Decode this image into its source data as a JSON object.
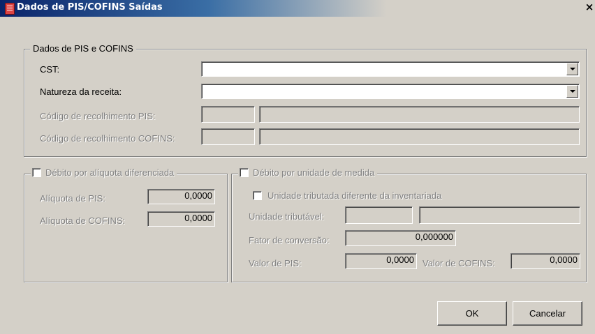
{
  "window": {
    "title": "Dados de PIS/COFINS Saídas",
    "close": "×"
  },
  "group_pis_cofins": {
    "legend": "Dados de PIS e COFINS",
    "cst_label": "CST:",
    "cst_value": "",
    "natureza_label": "Natureza da receita:",
    "natureza_value": "",
    "cod_pis_label": "Código de recolhimento PIS:",
    "cod_cofins_label": "Código de recolhimento COFINS:"
  },
  "group_aliquota": {
    "legend": "Débito por alíquota diferenciada",
    "checked": false,
    "aliq_pis_label": "Alíquota de PIS:",
    "aliq_pis_value": "0,0000",
    "aliq_cofins_label": "Alíquota de COFINS:",
    "aliq_cofins_value": "0,0000"
  },
  "group_unidade": {
    "legend": "Débito por unidade de medida",
    "checked": false,
    "unidade_diff_label": "Unidade tributada diferente da inventariada",
    "unidade_diff_checked": false,
    "unidade_trib_label": "Unidade tributável:",
    "fator_label": "Fator de conversão:",
    "fator_value": "0,000000",
    "valor_pis_label": "Valor de PIS:",
    "valor_pis_value": "0,0000",
    "valor_cofins_label": "Valor de COFINS:",
    "valor_cofins_value": "0,0000"
  },
  "buttons": {
    "ok": "OK",
    "cancel": "Cancelar"
  }
}
